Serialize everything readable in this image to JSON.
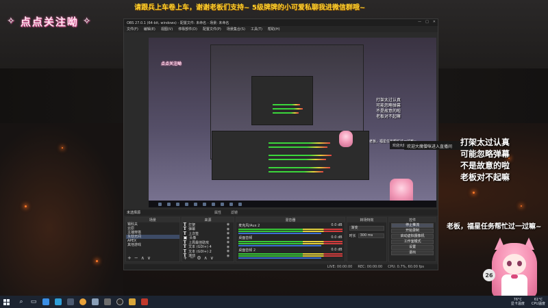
{
  "overlay": {
    "follow_text": "点点关注呦",
    "scroll_banner": "请跟兵上车卷上车，谢谢老板们支持~ 5级牌牌的小可爱私聊我进微信群哦~",
    "danmu_lines": [
      "打架太过认真",
      "可能忽略弹幕",
      "不是故意的啦",
      "老板对不起嘛"
    ],
    "bottom_marquee": "老板，福星任务帮忙过一过嘛~",
    "badge_number": "26"
  },
  "obs": {
    "title": "OBS 27.0.1 (64-bit, windows) - 配置文件: 未命名 - 场景: 未命名",
    "window_controls": [
      "—",
      "□",
      "✕"
    ],
    "menu": [
      "文件(F)",
      "编辑(E)",
      "视图(V)",
      "停靠部件(D)",
      "配置文件(P)",
      "场景集合(S)",
      "工具(T)",
      "帮助(H)"
    ],
    "no_source_label": "未选择源",
    "source_toolbar": [
      "属性",
      "滤镜"
    ],
    "docks": {
      "scenes_title": "场景",
      "sources_title": "来源",
      "mixer_title": "混音器",
      "transitions_title": "转场特效",
      "controls_title": "控件"
    },
    "scenes": [
      "锡科夫",
      "云原",
      "主播穿搭",
      "永劫无间",
      "APEX",
      "其他游戏"
    ],
    "selected_scene_index": 3,
    "sources": [
      "打架",
      "弹幕",
      "上次签",
      "头像",
      "上周最佳助攻",
      "文本 (GDI+) 4",
      "文本 (GDI+) 2",
      "滚动",
      "上次打卡"
    ],
    "mixer": [
      {
        "name": "麦克风/Aux 2",
        "db": "0.0 dB"
      },
      {
        "name": "桌面音频",
        "db": "0.0 dB"
      },
      {
        "name": "桌面音频 2",
        "db": "0.0 dB"
      }
    ],
    "transition": {
      "type": "渐变",
      "duration_label": "时长",
      "duration_value": "300 ms"
    },
    "controls": [
      "停止推流",
      "开始录制",
      "启动虚拟摄像机",
      "工作室模式",
      "设置",
      "退出"
    ],
    "status": {
      "live": "LIVE: 00:00:00",
      "rec": "REC: 00:00:00",
      "cpu": "CPU: 0.7%, 60.00 fps"
    },
    "preview_title": "请跟兵上车卷上车，谢谢老板们支持~ 5级牌牌的小可爱私聊我进微信群哦~",
    "preview_chat": "欢迎大魔僧咪进入直播间",
    "preview_note": "老板，福星任务帮忙过一过嘛~",
    "preview_badge": "点点关注呦"
  },
  "taskbar": {
    "search_icon": "search-icon",
    "weather_temp": "76°C",
    "weather_label": "显卡温度",
    "cpu_temp": "61°C",
    "cpu_label": "CPU温度"
  }
}
